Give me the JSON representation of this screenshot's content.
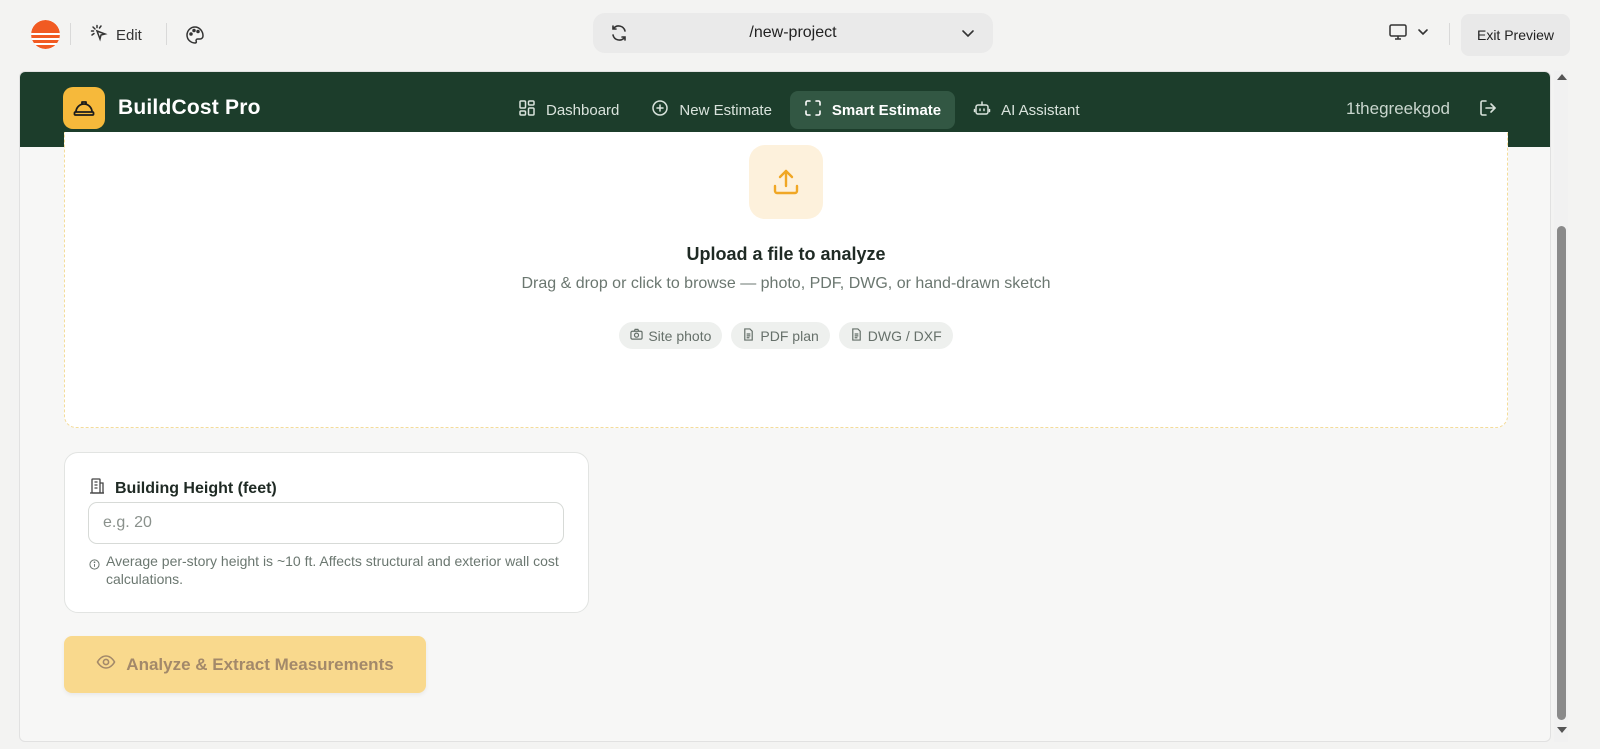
{
  "chrome": {
    "edit_label": "Edit",
    "url_path": "/new-project",
    "exit_label": "Exit Preview"
  },
  "app": {
    "brand": "BuildCost Pro",
    "nav": [
      {
        "label": "Dashboard",
        "icon": "grid-icon",
        "active": false
      },
      {
        "label": "New Estimate",
        "icon": "plus-circle-icon",
        "active": false
      },
      {
        "label": "Smart Estimate",
        "icon": "scan-icon",
        "active": true
      },
      {
        "label": "AI Assistant",
        "icon": "bot-icon",
        "active": false
      }
    ],
    "username": "1thegreekgod"
  },
  "upload": {
    "title": "Upload a file to analyze",
    "subtitle": "Drag & drop or click to browse — photo, PDF, DWG, or hand-drawn sketch",
    "chips": [
      {
        "label": "Site photo",
        "icon": "camera-icon"
      },
      {
        "label": "PDF plan",
        "icon": "file-icon"
      },
      {
        "label": "DWG / DXF",
        "icon": "file-icon"
      }
    ]
  },
  "height": {
    "label": "Building Height (feet)",
    "placeholder": "e.g. 20",
    "value": "",
    "help": "Average per-story height is ~10 ft. Affects structural and exterior wall cost calculations."
  },
  "action": {
    "analyze_label": "Analyze & Extract Measurements",
    "enabled": false
  },
  "colors": {
    "nav_bg": "#1c3d2b",
    "accent": "#f6b93b",
    "disabled_button": "#f9d98d"
  }
}
